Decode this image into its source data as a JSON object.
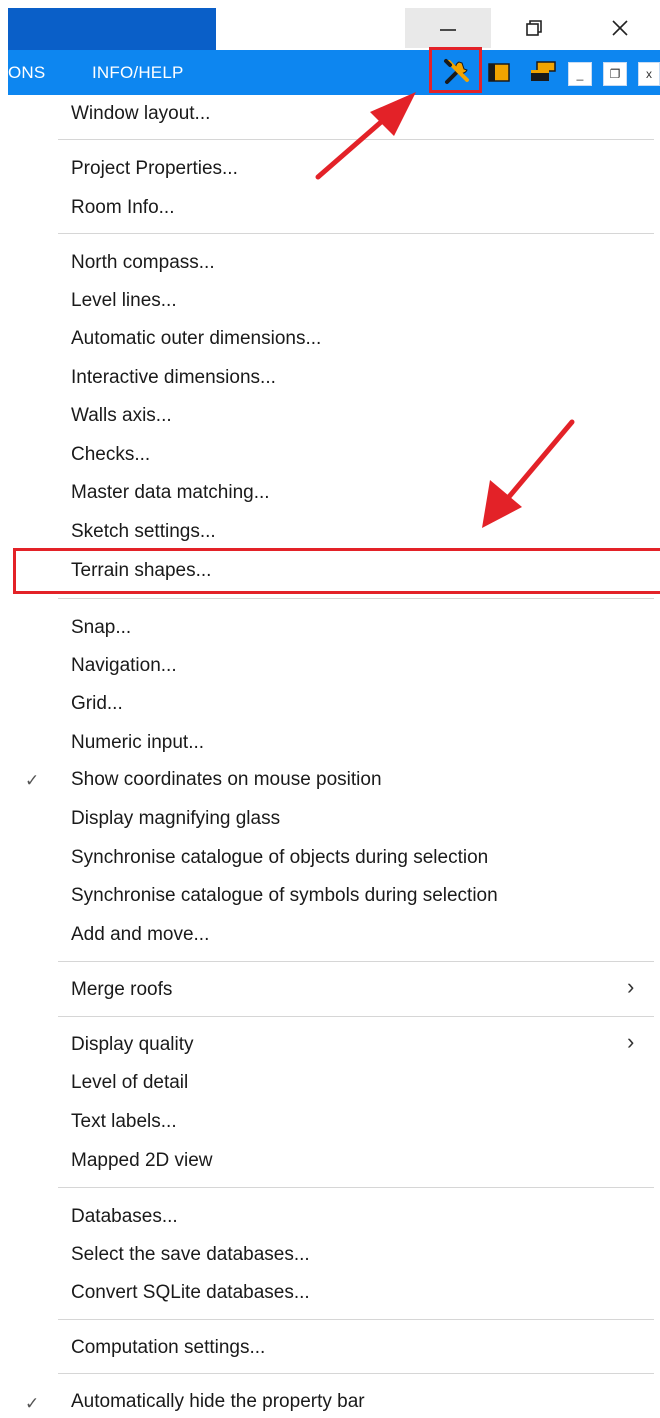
{
  "window": {
    "controls": {
      "minimize_icon": "minimize-icon",
      "maximize_icon": "restore-icon",
      "close_icon": "close-icon"
    },
    "title_color": "#0a5fc8"
  },
  "menubar": {
    "left_partial": "ONS",
    "info_help": "INFO/HELP",
    "color": "#0d86f0"
  },
  "toolbar": {
    "icons": [
      "tools-icon",
      "panel-icon",
      "window-stack-icon",
      "minimize-small-icon",
      "restore-small-icon",
      "close-small-icon"
    ],
    "min_glyph": "_",
    "restore_glyph": "❐",
    "close_glyph": "x"
  },
  "menu": {
    "items": [
      {
        "label": "Window layout..."
      },
      {
        "label": "Project Properties..."
      },
      {
        "label": "Room Info..."
      },
      {
        "label": "North compass..."
      },
      {
        "label": "Level lines..."
      },
      {
        "label": "Automatic outer dimensions..."
      },
      {
        "label": "Interactive dimensions..."
      },
      {
        "label": "Walls axis..."
      },
      {
        "label": "Checks..."
      },
      {
        "label": "Master data matching..."
      },
      {
        "label": "Sketch settings..."
      },
      {
        "label": "Terrain shapes..."
      },
      {
        "label": "Snap..."
      },
      {
        "label": "Navigation..."
      },
      {
        "label": "Grid..."
      },
      {
        "label": "Numeric input..."
      },
      {
        "label": "Show coordinates on mouse position",
        "checked": true
      },
      {
        "label": "Display magnifying glass"
      },
      {
        "label": "Synchronise catalogue of objects during selection"
      },
      {
        "label": "Synchronise catalogue of symbols during selection"
      },
      {
        "label": "Add and move..."
      },
      {
        "label": "Merge roofs",
        "submenu": true
      },
      {
        "label": "Display quality",
        "submenu": true
      },
      {
        "label": "Level of detail"
      },
      {
        "label": "Text labels..."
      },
      {
        "label": "Mapped 2D view"
      },
      {
        "label": "Databases..."
      },
      {
        "label": "Select the save databases..."
      },
      {
        "label": "Convert SQLite databases..."
      },
      {
        "label": "Computation settings..."
      },
      {
        "label": "Automatically hide the property bar",
        "checked": true
      }
    ],
    "check_glyph": "✓",
    "submenu_glyph": "›"
  },
  "annotations": {
    "highlight_color": "#e32228"
  }
}
